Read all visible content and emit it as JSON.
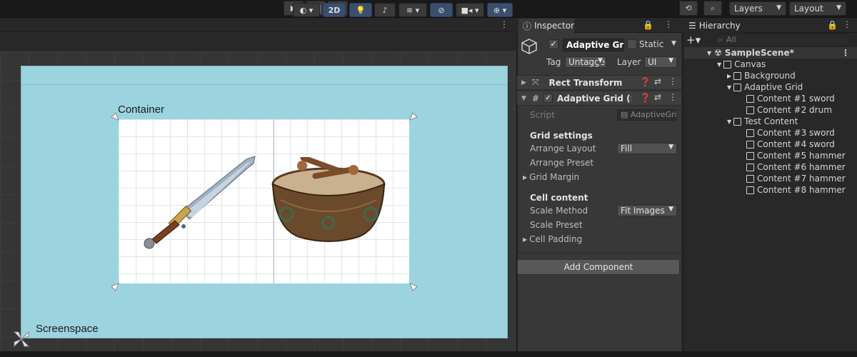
{
  "toolbar": {
    "play_icon": "play-icon",
    "pause_icon": "pause-icon",
    "step_icon": "step-icon",
    "layers_label": "Layers",
    "layout_label": "Layout"
  },
  "scene_tools": {
    "mode_2d_label": "2D"
  },
  "scene": {
    "container_label": "Container",
    "screenspace_label": "Screenspace"
  },
  "inspector": {
    "tab_label": "Inspector",
    "object_name": "Adaptive Grid",
    "static_label": "Static",
    "tag_label": "Tag",
    "tag_value": "Untagged",
    "layer_label": "Layer",
    "layer_value": "UI",
    "rect_transform_label": "Rect Transform",
    "component_label": "Adaptive Grid (Script)",
    "script_label": "Script",
    "script_value": "AdaptiveGrid",
    "grid_settings_heading": "Grid settings",
    "arrange_layout_label": "Arrange Layout",
    "arrange_layout_value": "Fill",
    "arrange_preset_label": "Arrange Preset",
    "grid_margin_label": "Grid Margin",
    "cell_content_heading": "Cell content",
    "scale_method_label": "Scale Method",
    "scale_method_value": "Fit Images",
    "scale_preset_label": "Scale Preset",
    "cell_padding_label": "Cell Padding",
    "add_component_label": "Add Component"
  },
  "hierarchy": {
    "tab_label": "Hierarchy",
    "search_placeholder": "All",
    "scene_name": "SampleScene*",
    "items": [
      {
        "label": "Canvas"
      },
      {
        "label": "Background"
      },
      {
        "label": "Adaptive Grid"
      },
      {
        "label": "Content #1 sword"
      },
      {
        "label": "Content #2 drum"
      },
      {
        "label": "Test Content"
      },
      {
        "label": "Content #3 sword"
      },
      {
        "label": "Content #4 sword"
      },
      {
        "label": "Content #5 hammer"
      },
      {
        "label": "Content #6 hammer"
      },
      {
        "label": "Content #7 hammer"
      },
      {
        "label": "Content #8 hammer"
      }
    ]
  },
  "colors": {
    "screenspace_bg": "#9bd3df",
    "container_bg": "#ffffff",
    "panel_bg": "#383838",
    "accent_blue": "#3a4f6e"
  }
}
